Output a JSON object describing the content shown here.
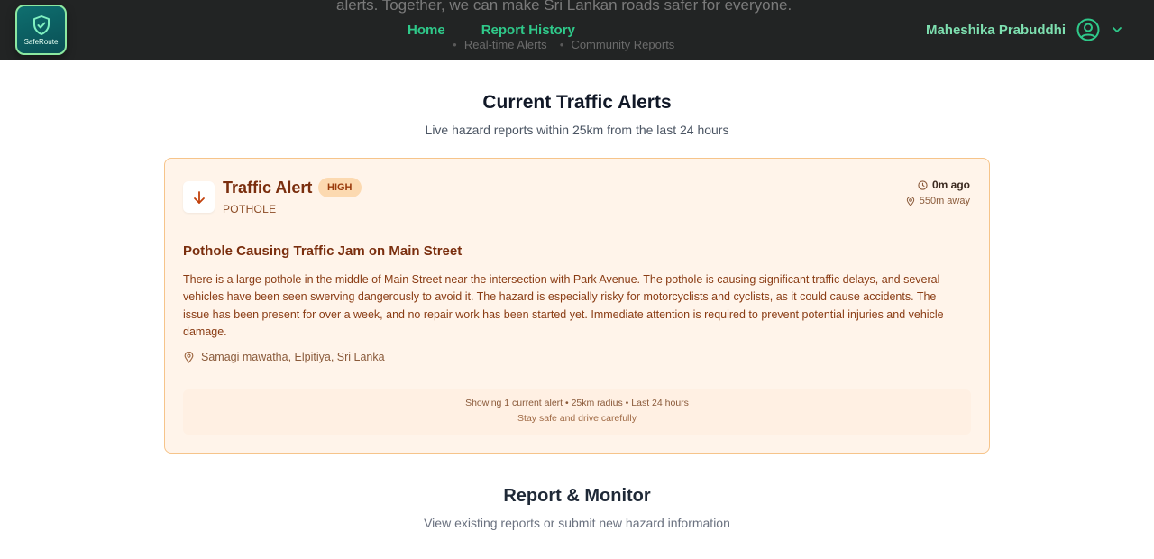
{
  "header": {
    "background_text": "alerts. Together, we can make Sri Lankan roads safer for everyone.",
    "background_bullets": [
      "Real-time Alerts",
      "Community Reports"
    ],
    "logo_text": "SafeRoute",
    "nav": [
      {
        "label": "Home"
      },
      {
        "label": "Report History"
      }
    ],
    "user_name": "Maheshika Prabuddhi"
  },
  "alerts_section": {
    "title": "Current Traffic Alerts",
    "subtitle": "Live hazard reports within 25km from the last 24 hours"
  },
  "alert_card": {
    "title": "Traffic Alert",
    "severity": "HIGH",
    "type": "POTHOLE",
    "time": "0m ago",
    "distance": "550m away",
    "report_title": "Pothole Causing Traffic Jam on Main Street",
    "description": "There is a large pothole in the middle of Main Street near the intersection with Park Avenue. The pothole is causing significant traffic delays, and several vehicles have been seen swerving dangerously to avoid it. The hazard is especially risky for motorcyclists and cyclists, as it could cause accidents. The issue has been present for over a week, and no repair work has been started yet. Immediate attention is required to prevent potential injuries and vehicle damage.",
    "location": "Samagi mawatha, Elpitiya, Sri Lanka",
    "footer_summary": "Showing 1 current alert • 25km radius • Last 24 hours",
    "footer_note": "Stay safe and drive carefully"
  },
  "monitor_section": {
    "title": "Report & Monitor",
    "subtitle": "View existing reports or submit new hazard information"
  },
  "colors": {
    "nav_bg": "#222424",
    "accent_green": "#2fc98a",
    "card_bg": "#fff4ea",
    "card_border": "#f6c48a",
    "severity_badge": "#fcd9b0"
  }
}
